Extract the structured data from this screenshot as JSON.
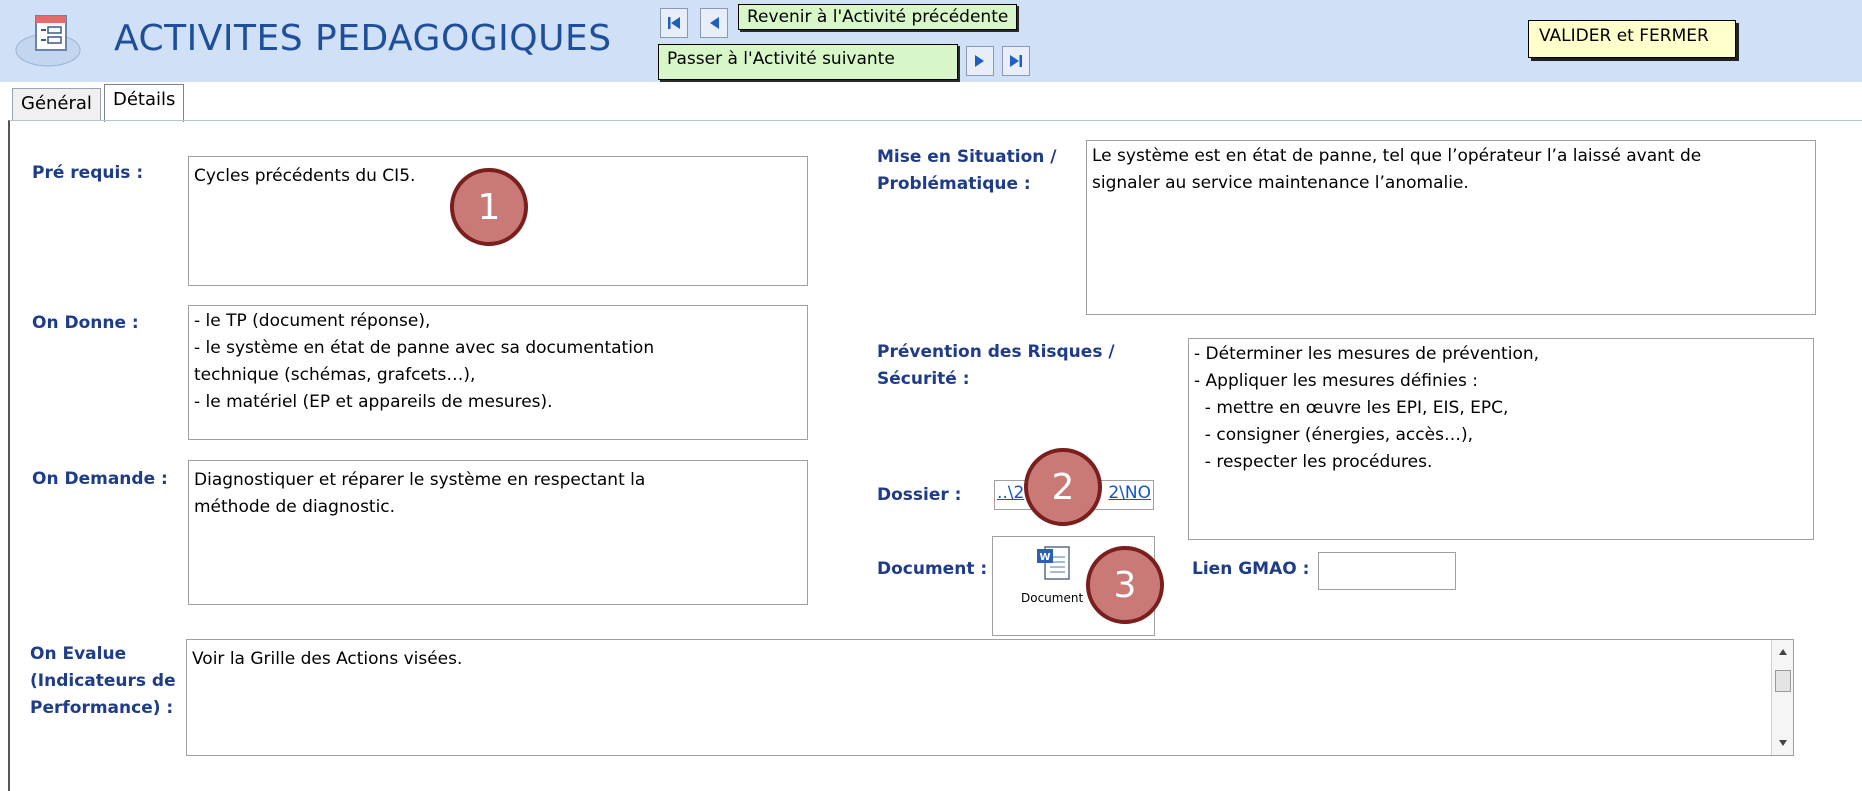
{
  "header": {
    "title": "ACTIVITES PEDAGOGIQUES",
    "prev_label": "Revenir à l'Activité précédente",
    "next_label": "Passer à l'Activité suivante",
    "validate_label": "VALIDER et FERMER"
  },
  "tabs": [
    {
      "label": "Général",
      "active": false
    },
    {
      "label": "Détails",
      "active": true
    }
  ],
  "form": {
    "prerequis": {
      "label": "Pré requis :",
      "value": "Cycles précédents du CI5."
    },
    "on_donne": {
      "label": "On Donne :",
      "lines": [
        "- le TP (document réponse),",
        "- le système en état de panne avec sa documentation",
        "technique (schémas, grafcets…),",
        "- le matériel (EP et appareils de mesures)."
      ]
    },
    "on_demande": {
      "label": "On Demande :",
      "lines": [
        "Diagnostiquer et réparer le système en respectant la",
        "méthode de diagnostic."
      ]
    },
    "on_evalue": {
      "label_lines": [
        "On Evalue",
        "(Indicateurs de",
        "Performance) :"
      ],
      "value": "Voir la Grille des Actions visées."
    },
    "mise_en_situation": {
      "label_lines": [
        "Mise en Situation /",
        "Problématique :"
      ],
      "lines": [
        "Le système est en état de panne, tel que l’opérateur l’a laissé avant de",
        "signaler au service maintenance l’anomalie."
      ]
    },
    "prevention": {
      "label_lines": [
        "Prévention des Risques /",
        "Sécurité :"
      ],
      "lines": [
        "- Déterminer les mesures de prévention,",
        "- Appliquer les mesures définies :",
        "  - mettre en œuvre les EPI, EIS, EPC,",
        "  - consigner (énergies, accès…),",
        "  - respecter les procédures."
      ]
    },
    "dossier": {
      "label": "Dossier :",
      "link_text_left": "..\\2",
      "link_text_right": "2\\NO"
    },
    "document": {
      "label": "Document :",
      "caption": "Document"
    },
    "lien_gmao": {
      "label": "Lien GMAO :",
      "value": ""
    }
  },
  "markers": [
    "1",
    "2",
    "3"
  ],
  "colors": {
    "header_bg": "#cfe0f7",
    "title": "#1f4e9a",
    "label": "#1f3c88",
    "nav_label_bg": "#d8f7c9",
    "validate_bg": "#ffffcc",
    "marker_fill": "#c97a77",
    "marker_border": "#7a1e1e",
    "link": "#1155cc"
  },
  "icons": [
    "form-icon",
    "first-record-icon",
    "prev-record-icon",
    "next-record-icon",
    "last-record-icon",
    "word-document-icon"
  ]
}
